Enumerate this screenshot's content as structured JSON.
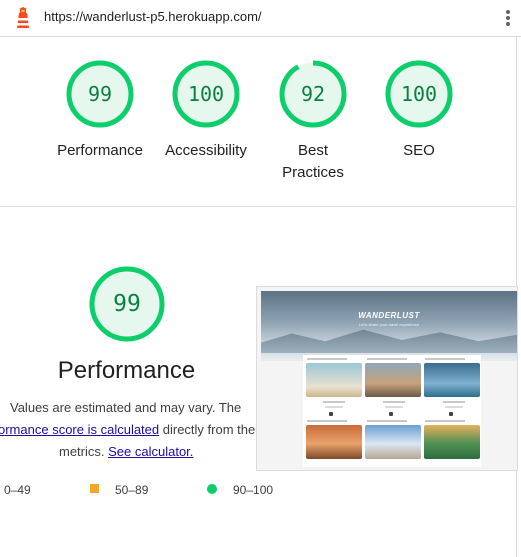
{
  "browser": {
    "url": "https://wanderlust-p5.herokuapp.com/",
    "logo_icon": "lighthouse-icon",
    "menu_icon": "kebab-menu-icon"
  },
  "summary": {
    "scores": [
      {
        "label": "Performance",
        "score": "99"
      },
      {
        "label": "Accessibility",
        "score": "100"
      },
      {
        "label": "Best Practices",
        "score": "92"
      },
      {
        "label": "SEO",
        "score": "100"
      }
    ]
  },
  "performance": {
    "score": "99",
    "title": "Performance",
    "note_line1": "Values are estimated and may vary. The",
    "note_link1": "ormance score is calculated",
    "note_line2_rest": " directly from the",
    "note_line3_prefix": "metrics. ",
    "note_link2": "See calculator."
  },
  "legend": {
    "fail": "0–49",
    "average": "50–89",
    "pass": "90–100"
  },
  "screenshot": {
    "hero_title": "WANDERLUST",
    "hero_subtitle": "Let's share your travel experience"
  },
  "colors": {
    "pass": "#0cce6b",
    "pass_text": "#0b8043",
    "average": "#f4a62a",
    "link": "#1a0dab"
  }
}
